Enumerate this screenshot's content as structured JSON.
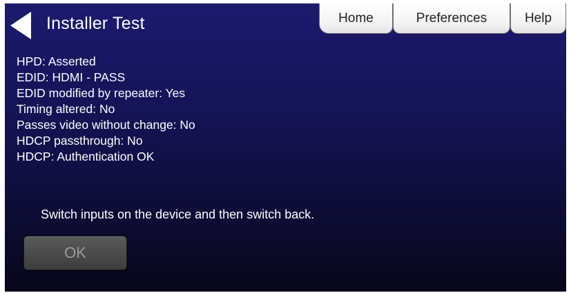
{
  "header": {
    "title": "Installer Test",
    "back_icon": "back-arrow-icon"
  },
  "tabs": [
    {
      "label": "Home"
    },
    {
      "label": "Preferences"
    },
    {
      "label": "Help"
    }
  ],
  "status_lines": [
    "HPD: Asserted",
    "EDID: HDMI - PASS",
    "EDID modified by repeater: Yes",
    "Timing altered: No",
    "Passes video without change: No",
    "HDCP passthrough: No",
    "HDCP: Authentication OK"
  ],
  "instruction": "Switch inputs on the device and then switch back.",
  "ok_label": "OK",
  "colors": {
    "background_top": "#1c1a6e",
    "background_bottom": "#07061a",
    "text": "#ffffff",
    "tab_bg": "#f2f2f2",
    "button_bg": "#4b4b4b",
    "button_text": "#9c9c9c"
  }
}
